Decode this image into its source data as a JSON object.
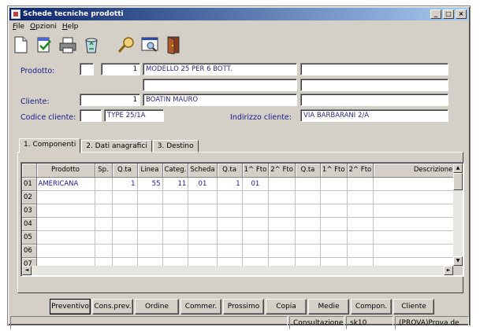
{
  "window": {
    "title": "Schede tecniche prodotti",
    "controls": [
      "_",
      "□",
      "×"
    ]
  },
  "menu": [
    "File",
    "Opzioni",
    "Help"
  ],
  "toolbar": {
    "icons": [
      "new-document-icon",
      "edit-check-icon",
      "print-icon",
      "recycle-bin-icon",
      "search-icon",
      "preview-icon",
      "exit-door-icon"
    ]
  },
  "form": {
    "prodotto_label": "Prodotto:",
    "prodotto_code1": "",
    "prodotto_num": "1",
    "prodotto_desc": "MODELLO 25 PER 6 BOTT.",
    "prodotto_extra1": "",
    "prodotto_desc2": "",
    "prodotto_extra2": "",
    "cliente_label": "Cliente:",
    "cliente_code": "",
    "cliente_num": "1",
    "cliente_name": "BOATIN MAURO",
    "cliente_extra": "",
    "codice_cliente_label": "Codice cliente:",
    "codice_cliente_code": "",
    "codice_cliente_type": "TYPE 25/1A",
    "indirizzo_label": "Indirizzo cliente:",
    "indirizzo_value": "VIA BARBARANI 2/A"
  },
  "tabs": [
    "1. Componenti",
    "2. Dati anagrafici",
    "3. Destino"
  ],
  "grid": {
    "columns": [
      "",
      "Prodotto",
      "Sp.",
      "Q.ta",
      "Linea",
      "Categ.",
      "Scheda",
      "Q.ta",
      "1^ Fto",
      "2^ Fto",
      "Q.ta",
      "1^ Fto",
      "2^ Fto",
      "Descrizione"
    ],
    "rows": [
      [
        "01",
        "AMERICANA",
        "",
        "1",
        "55",
        "11",
        "01",
        "1",
        "01",
        "",
        "",
        "",
        "",
        ""
      ],
      [
        "02",
        "",
        "",
        "",
        "",
        "",
        "",
        "",
        "",
        "",
        "",
        "",
        "",
        ""
      ],
      [
        "03",
        "",
        "",
        "",
        "",
        "",
        "",
        "",
        "",
        "",
        "",
        "",
        "",
        ""
      ],
      [
        "04",
        "",
        "",
        "",
        "",
        "",
        "",
        "",
        "",
        "",
        "",
        "",
        "",
        ""
      ],
      [
        "05",
        "",
        "",
        "",
        "",
        "",
        "",
        "",
        "",
        "",
        "",
        "",
        "",
        ""
      ],
      [
        "06",
        "",
        "",
        "",
        "",
        "",
        "",
        "",
        "",
        "",
        "",
        "",
        "",
        ""
      ],
      [
        "07",
        "",
        "",
        "",
        "",
        "",
        "",
        "",
        "",
        "",
        "",
        "",
        "",
        ""
      ]
    ]
  },
  "buttons": [
    "Preventivo",
    "Cons.prev.",
    "Ordine",
    "Commer.",
    "Prossimo",
    "Copia",
    "Medie",
    "Compon.",
    "Cliente"
  ],
  "status": {
    "panel1": "",
    "panel2": "Consultazione",
    "panel3": "sk10",
    "panel4": "(PROVA)Prova de"
  }
}
